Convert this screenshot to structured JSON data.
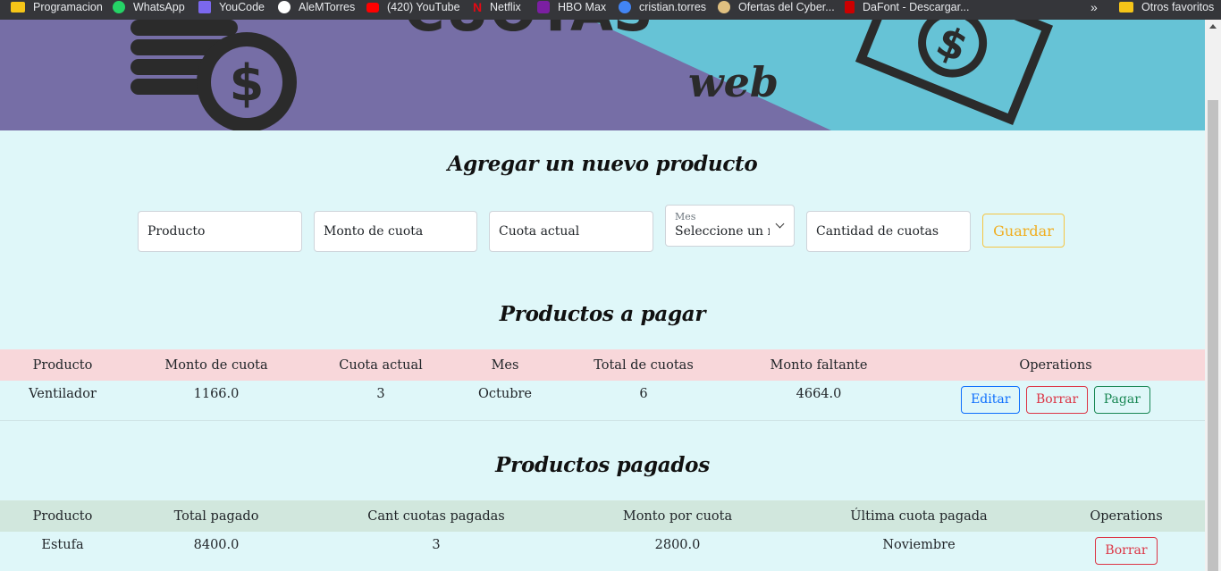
{
  "bookmarks": [
    {
      "label": "Programacion",
      "icon": "folder-icon",
      "color": "#f5c518"
    },
    {
      "label": "WhatsApp",
      "icon": "whatsapp-icon",
      "color": "#25d366"
    },
    {
      "label": "YouCode",
      "icon": "youcode-icon",
      "color": "#7b68ee"
    },
    {
      "label": "AleMTorres",
      "icon": "github-icon",
      "color": "#ffffff"
    },
    {
      "label": "(420) YouTube",
      "icon": "youtube-icon",
      "color": "#ff0000"
    },
    {
      "label": "Netflix",
      "icon": "netflix-icon",
      "color": "#e50914"
    },
    {
      "label": "HBO Max",
      "icon": "hbomax-icon",
      "color": "#7b1fa2"
    },
    {
      "label": "cristian.torres",
      "icon": "avatar-icon",
      "color": "#4285f4"
    },
    {
      "label": "Ofertas del Cyber...",
      "icon": "offers-icon",
      "color": "#e0c080"
    },
    {
      "label": "DaFont - Descargar...",
      "icon": "dafont-icon",
      "color": "#cc0000"
    }
  ],
  "bookmarks_more": "»",
  "other_bookmarks": "Otros favoritos",
  "banner": {
    "logo_text": "CUOTAS",
    "logo_sub": "web",
    "colors": {
      "left": "#766ea6",
      "right": "#66c3d6",
      "ink": "#2b2b2b"
    }
  },
  "form": {
    "title": "Agregar un nuevo producto",
    "producto_placeholder": "Producto",
    "monto_placeholder": "Monto de cuota",
    "cuota_actual_placeholder": "Cuota actual",
    "mes_label": "Mes",
    "mes_value": "Seleccione un mes",
    "cantidad_placeholder": "Cantidad de cuotas",
    "guardar_label": "Guardar"
  },
  "pending": {
    "title": "Productos a pagar",
    "headers": [
      "Producto",
      "Monto de cuota",
      "Cuota actual",
      "Mes",
      "Total de cuotas",
      "Monto faltante",
      "Operations"
    ],
    "rows": [
      {
        "producto": "Ventilador",
        "monto": "1166.0",
        "cuota_actual": "3",
        "mes": "Octubre",
        "total": "6",
        "faltante": "4664.0"
      }
    ],
    "edit_label": "Editar",
    "delete_label": "Borrar",
    "pay_label": "Pagar"
  },
  "paid": {
    "title": "Productos pagados",
    "headers": [
      "Producto",
      "Total pagado",
      "Cant cuotas pagadas",
      "Monto por cuota",
      "Última cuota pagada",
      "Operations"
    ],
    "rows": [
      {
        "producto": "Estufa",
        "total": "8400.0",
        "cant": "3",
        "monto": "2800.0",
        "ultima": "Noviembre"
      }
    ],
    "delete_label": "Borrar"
  }
}
